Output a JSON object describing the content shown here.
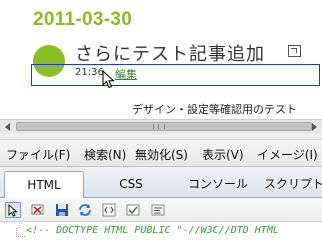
{
  "post": {
    "date": "2011-03-30",
    "title": "さらにテスト記事追加",
    "time": "21:36",
    "edit_link": "編集",
    "excerpt": "デザイン・設定等確認用のテスト"
  },
  "menubar": {
    "items": [
      "ファイル(F)",
      "検索(N)",
      "無効化(S)",
      "表示(V)",
      "イメージ(I)"
    ]
  },
  "tabs": [
    "HTML",
    "CSS",
    "コンソール",
    "スクリプト"
  ],
  "active_tab": "HTML",
  "toolbar": {
    "icons": [
      "select-element-icon",
      "clear-icon",
      "save-icon",
      "refresh-icon",
      "view-source-icon",
      "validate-icon",
      "edit-icon"
    ]
  },
  "source": {
    "line": "<!-- DOCTYPE HTML PUBLIC \"-//W3C//DTD HTML"
  },
  "colors": {
    "date": "#8cb82b",
    "badge": "#8cbe26",
    "highlight": "#1c3dbd",
    "comment": "#3a9a3a"
  }
}
